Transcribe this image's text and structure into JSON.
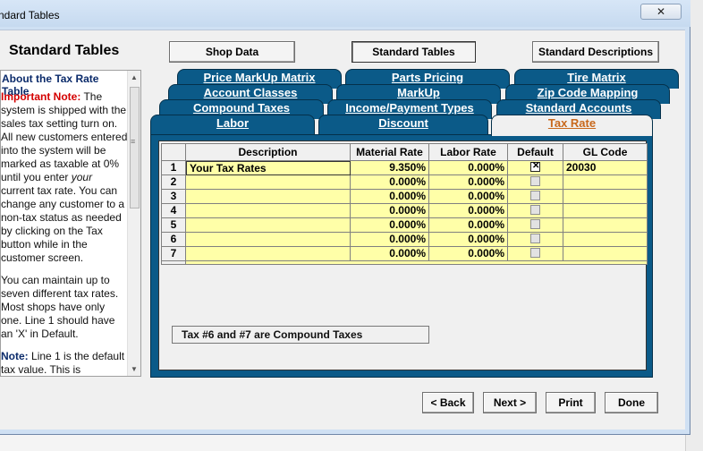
{
  "window": {
    "title": "ndard Tables",
    "close_glyph": "✕"
  },
  "header": {
    "title": "Standard Tables"
  },
  "top_buttons": {
    "shop_data": "Shop Data",
    "standard_tables": "Standard Tables",
    "standard_descriptions": "Standard Descriptions"
  },
  "help": {
    "heading": "About the Tax Rate Table",
    "p1_label": "Important Note:",
    "p1_text": "The system is shipped with the sales tax setting turn on. All new customers entered into the system will be marked as taxable at 0% until you enter ",
    "p1_italic": "your",
    "p1_text2": " current tax rate. You can change any customer to a non-tax status as needed by clicking on the Tax button while in the customer screen.",
    "p2_text": "You can maintain up to seven different tax rates. Most shops have only one. Line 1 should have an 'X' in Default.",
    "p3_label": "Note:",
    "p3_text": "Line 1 is the default tax value. This is"
  },
  "tabs": {
    "row1": [
      "Price MarkUp Matrix",
      "Parts Pricing",
      "Tire Matrix"
    ],
    "row2": [
      "Account Classes",
      "MarkUp",
      "Zip Code Mapping"
    ],
    "row3": [
      "Compound Taxes",
      "Income/Payment Types",
      "Standard Accounts"
    ],
    "row4": [
      "Labor",
      "Discount",
      "Tax Rate"
    ]
  },
  "grid": {
    "columns": [
      "Description",
      "Material Rate",
      "Labor Rate",
      "Default",
      "GL Code"
    ],
    "rows": [
      {
        "num": "1",
        "description": "Your Tax Rates",
        "material": "9.350%",
        "labor": "0.000%",
        "default": true,
        "gl": "20030"
      },
      {
        "num": "2",
        "description": "",
        "material": "0.000%",
        "labor": "0.000%",
        "default": false,
        "gl": ""
      },
      {
        "num": "3",
        "description": "",
        "material": "0.000%",
        "labor": "0.000%",
        "default": false,
        "gl": ""
      },
      {
        "num": "4",
        "description": "",
        "material": "0.000%",
        "labor": "0.000%",
        "default": false,
        "gl": ""
      },
      {
        "num": "5",
        "description": "",
        "material": "0.000%",
        "labor": "0.000%",
        "default": false,
        "gl": ""
      },
      {
        "num": "6",
        "description": "",
        "material": "0.000%",
        "labor": "0.000%",
        "default": false,
        "gl": ""
      },
      {
        "num": "7",
        "description": "",
        "material": "0.000%",
        "labor": "0.000%",
        "default": false,
        "gl": ""
      }
    ]
  },
  "compound_note": "Tax #6 and #7 are Compound Taxes",
  "nav_buttons": {
    "back": "< Back",
    "next": "Next >",
    "print": "Print",
    "done": "Done"
  },
  "colors": {
    "tab_blue": "#0b5a88",
    "active_tab_text": "#c8681c",
    "grid_yellow": "#ffffa8",
    "important_red": "#d40000"
  }
}
